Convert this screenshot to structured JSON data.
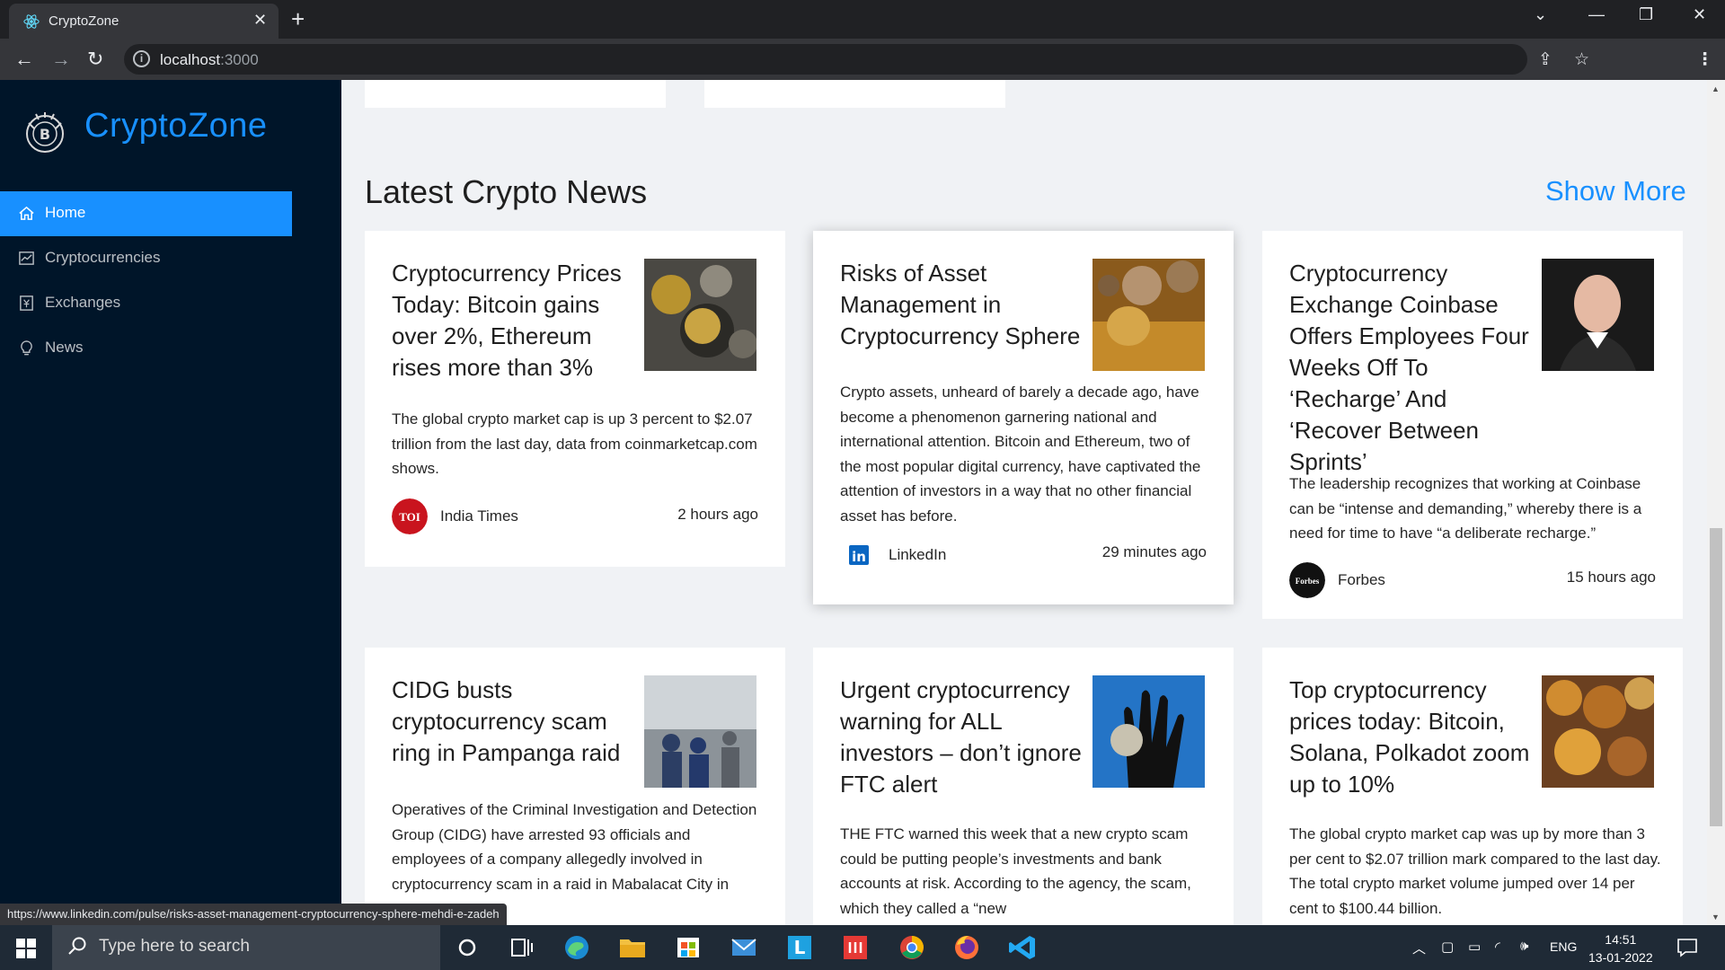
{
  "browser": {
    "tab_title": "CryptoZone",
    "url_host": "localhost",
    "url_port": ":3000",
    "status_url": "https://www.linkedin.com/pulse/risks-asset-management-cryptocurrency-sphere-mehdi-e-zadeh"
  },
  "sidebar": {
    "brand": "CryptoZone",
    "items": [
      {
        "label": "Home",
        "icon": "home-icon"
      },
      {
        "label": "Cryptocurrencies",
        "icon": "fund-chart-icon"
      },
      {
        "label": "Exchanges",
        "icon": "money-collect-icon"
      },
      {
        "label": "News",
        "icon": "bulb-icon"
      }
    ]
  },
  "main": {
    "section_title": "Latest Crypto News",
    "show_more": "Show More",
    "news": [
      {
        "title": "Cryptocurrency Prices Today: Bitcoin gains over 2%, Ethereum rises more than 3%",
        "description": "The global crypto market cap is up 3 percent to $2.07 trillion from the last day, data from coinmarketcap.com shows.",
        "provider": "India Times",
        "provider_logo_text": "TOI",
        "time": "2 hours ago"
      },
      {
        "title": "Risks of Asset Management in Cryptocurrency Sphere",
        "description": "Crypto assets, unheard of barely a decade ago, have become a phenomenon garnering national and international attention. Bitcoin and Ethereum, two of the most popular digital currency, have captivated the attention of investors in a way that no other financial asset has before.",
        "provider": "LinkedIn",
        "provider_logo_text": "in",
        "time": "29 minutes ago"
      },
      {
        "title": "Cryptocurrency Exchange Coinbase Offers Employees Four Weeks Off To ‘Recharge’ And ‘Recover Between Sprints’",
        "description": "The leadership recognizes that working at Coinbase can be “intense and demanding,” whereby there is a need for time to have “a deliberate recharge.”",
        "provider": "Forbes",
        "provider_logo_text": "Forbes",
        "time": "15 hours ago"
      },
      {
        "title": "CIDG busts cryptocurrency scam ring in Pampanga raid",
        "description": "Operatives of the Criminal Investigation and Detection Group (CIDG) have arrested 93 officials and employees of a company allegedly involved in cryptocurrency scam in a raid in Mabalacat City in",
        "provider": "",
        "provider_logo_text": "",
        "time": ""
      },
      {
        "title": "Urgent cryptocurrency warning for ALL investors – don’t ignore FTC alert",
        "description": "THE FTC warned this week that a new crypto scam could be putting people’s investments and bank accounts at risk. According to the agency, the scam, which they called a “new",
        "provider": "",
        "provider_logo_text": "",
        "time": ""
      },
      {
        "title": "Top cryptocurrency prices today: Bitcoin, Solana, Polkadot zoom up to 10%",
        "description": "The global crypto market cap was up by more than 3 per cent to $2.07 trillion mark compared to the last day. The total crypto market volume jumped over 14 per cent to $100.44 billion.",
        "provider": "",
        "provider_logo_text": "",
        "time": ""
      }
    ]
  },
  "taskbar": {
    "search_placeholder": "Type here to search",
    "language": "ENG",
    "time": "14:51",
    "date": "13-01-2022"
  }
}
